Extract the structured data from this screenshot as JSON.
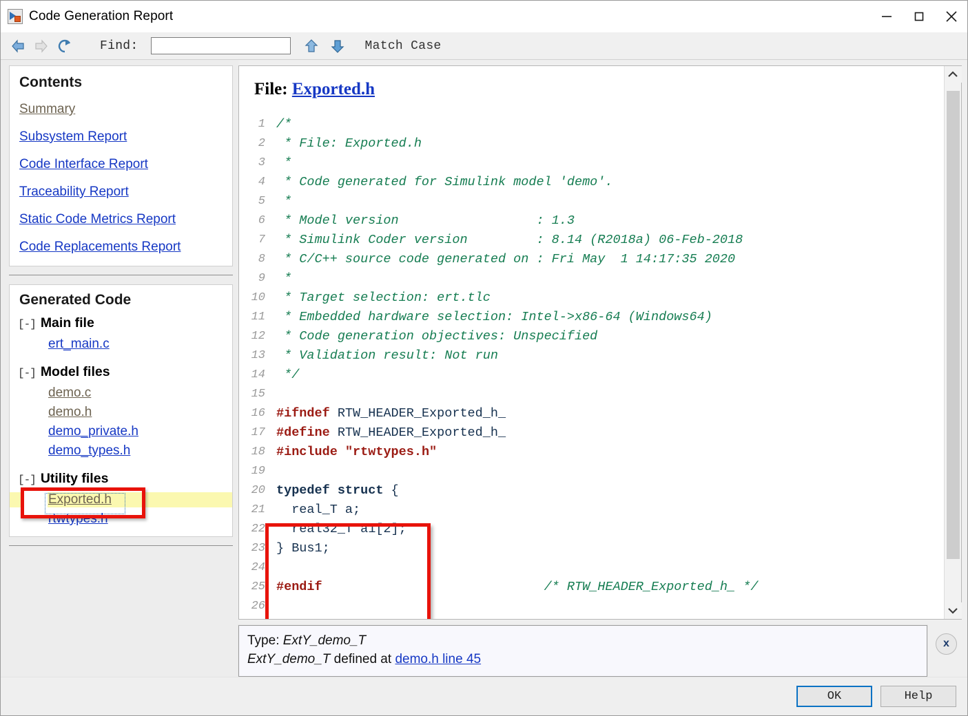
{
  "window": {
    "title": "Code Generation Report",
    "app_icon": "simulink-icon",
    "minimize_label": "minimize-icon",
    "maximize_label": "maximize-icon",
    "close_label": "close-icon"
  },
  "toolbar": {
    "back_icon": "back-arrow-icon",
    "forward_icon": "forward-arrow-icon",
    "refresh_icon": "refresh-icon",
    "find_label": "Find:",
    "find_value": "",
    "find_placeholder": "",
    "find_prev_icon": "arrow-up-icon",
    "find_next_icon": "arrow-down-icon",
    "match_case_label": "Match Case"
  },
  "sidebar": {
    "contents": {
      "heading": "Contents",
      "links": [
        {
          "label": "Summary",
          "state": "visited"
        },
        {
          "label": "Subsystem Report",
          "state": "normal"
        },
        {
          "label": "Code Interface Report",
          "state": "normal"
        },
        {
          "label": "Traceability Report",
          "state": "normal"
        },
        {
          "label": "Static Code Metrics Report",
          "state": "normal"
        },
        {
          "label": "Code Replacements Report",
          "state": "normal"
        }
      ]
    },
    "generated_code": {
      "heading": "Generated Code",
      "toggle_glyph": "[-]",
      "groups": [
        {
          "label": "Main file",
          "files": [
            {
              "label": "ert_main.c",
              "state": "normal"
            }
          ]
        },
        {
          "label": "Model files",
          "files": [
            {
              "label": "demo.c",
              "state": "visited"
            },
            {
              "label": "demo.h",
              "state": "visited"
            },
            {
              "label": "demo_private.h",
              "state": "normal"
            },
            {
              "label": "demo_types.h",
              "state": "normal"
            }
          ]
        },
        {
          "label": "Utility files",
          "files": [
            {
              "label": "Exported.h",
              "state": "visited-selected"
            },
            {
              "label": "rtwtypes.h",
              "state": "normal"
            }
          ]
        }
      ]
    }
  },
  "document": {
    "heading_prefix": "File:",
    "heading_link": "Exported.h",
    "code_lines": [
      {
        "n": "1",
        "tokens": [
          {
            "t": "comment",
            "s": "/*"
          }
        ]
      },
      {
        "n": "2",
        "tokens": [
          {
            "t": "comment",
            "s": " * File: Exported.h"
          }
        ]
      },
      {
        "n": "3",
        "tokens": [
          {
            "t": "comment",
            "s": " *"
          }
        ]
      },
      {
        "n": "4",
        "tokens": [
          {
            "t": "comment",
            "s": " * Code generated for Simulink model 'demo'."
          }
        ]
      },
      {
        "n": "5",
        "tokens": [
          {
            "t": "comment",
            "s": " *"
          }
        ]
      },
      {
        "n": "6",
        "tokens": [
          {
            "t": "comment",
            "s": " * Model version                  : 1.3"
          }
        ]
      },
      {
        "n": "7",
        "tokens": [
          {
            "t": "comment",
            "s": " * Simulink Coder version         : 8.14 (R2018a) 06-Feb-2018"
          }
        ]
      },
      {
        "n": "8",
        "tokens": [
          {
            "t": "comment",
            "s": " * C/C++ source code generated on : Fri May  1 14:17:35 2020"
          }
        ]
      },
      {
        "n": "9",
        "tokens": [
          {
            "t": "comment",
            "s": " *"
          }
        ]
      },
      {
        "n": "10",
        "tokens": [
          {
            "t": "comment",
            "s": " * Target selection: ert.tlc"
          }
        ]
      },
      {
        "n": "11",
        "tokens": [
          {
            "t": "comment",
            "s": " * Embedded hardware selection: Intel->x86-64 (Windows64)"
          }
        ]
      },
      {
        "n": "12",
        "tokens": [
          {
            "t": "comment",
            "s": " * Code generation objectives: Unspecified"
          }
        ]
      },
      {
        "n": "13",
        "tokens": [
          {
            "t": "comment",
            "s": " * Validation result: Not run"
          }
        ]
      },
      {
        "n": "14",
        "tokens": [
          {
            "t": "comment",
            "s": " */"
          }
        ]
      },
      {
        "n": "15",
        "tokens": [
          {
            "t": "plain",
            "s": ""
          }
        ]
      },
      {
        "n": "16",
        "tokens": [
          {
            "t": "preproc",
            "s": "#ifndef"
          },
          {
            "t": "plain",
            "s": " "
          },
          {
            "t": "ident",
            "s": "RTW_HEADER_Exported_h_"
          }
        ]
      },
      {
        "n": "17",
        "tokens": [
          {
            "t": "preproc",
            "s": "#define"
          },
          {
            "t": "plain",
            "s": " "
          },
          {
            "t": "ident",
            "s": "RTW_HEADER_Exported_h_"
          }
        ]
      },
      {
        "n": "18",
        "tokens": [
          {
            "t": "preproc",
            "s": "#include"
          },
          {
            "t": "plain",
            "s": " "
          },
          {
            "t": "string",
            "s": "\"rtwtypes.h\""
          }
        ]
      },
      {
        "n": "19",
        "tokens": [
          {
            "t": "plain",
            "s": ""
          }
        ]
      },
      {
        "n": "20",
        "tokens": [
          {
            "t": "keyword",
            "s": "typedef struct"
          },
          {
            "t": "ident",
            "s": " {"
          }
        ]
      },
      {
        "n": "21",
        "tokens": [
          {
            "t": "ident",
            "s": "  real_T a;"
          }
        ]
      },
      {
        "n": "22",
        "tokens": [
          {
            "t": "ident",
            "s": "  real32_T a1[2];"
          }
        ]
      },
      {
        "n": "23",
        "tokens": [
          {
            "t": "ident",
            "s": "} Bus1;"
          }
        ]
      },
      {
        "n": "24",
        "tokens": [
          {
            "t": "plain",
            "s": ""
          }
        ]
      },
      {
        "n": "25",
        "tokens": [
          {
            "t": "preproc",
            "s": "#endif"
          },
          {
            "t": "plain",
            "s": "                             "
          },
          {
            "t": "comment",
            "s": "/* RTW_HEADER_Exported_h_ */"
          }
        ]
      },
      {
        "n": "26",
        "tokens": [
          {
            "t": "plain",
            "s": ""
          }
        ]
      }
    ],
    "scrollbar": {
      "up_icon": "chevron-up-icon",
      "down_icon": "chevron-down-icon"
    }
  },
  "info_panel": {
    "line1_prefix": "Type: ",
    "line1_type": "ExtY_demo_T",
    "line2_type": "ExtY_demo_T",
    "line2_middle": " defined at ",
    "line2_link": "demo.h line 45",
    "close_label": "x"
  },
  "footer": {
    "ok_label": "OK",
    "help_label": "Help"
  },
  "colors": {
    "link": "#1638c4",
    "visited_link": "#6d6351",
    "comment_green": "#167d52",
    "preproc_red": "#9b1b13",
    "identifier_navy": "#16314f",
    "annotation_red": "#e8130b",
    "highlight_yellow": "#fbf8b0",
    "focus_blue": "#0b72c4"
  }
}
